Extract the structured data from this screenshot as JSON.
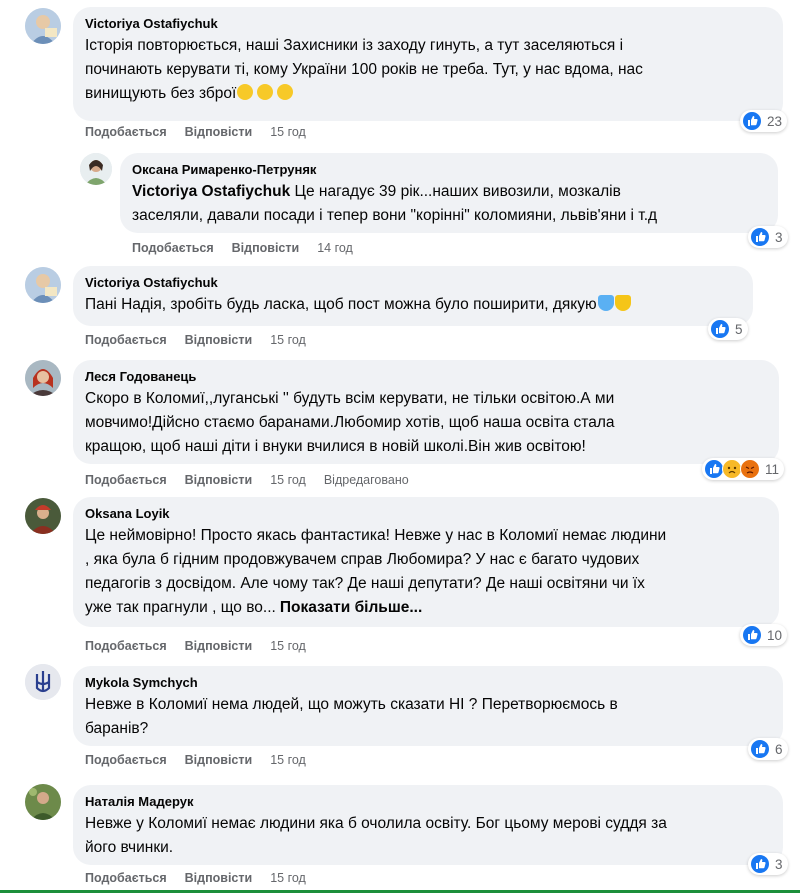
{
  "labels": {
    "like": "Подобається",
    "reply": "Відповісти"
  },
  "colors": {
    "like_blue": "#1877f2",
    "sad_yellow": "#f7b928",
    "angry_red": "#e9710f",
    "heart_blue": "#5ab0f3",
    "heart_yellow": "#f5c518"
  },
  "comments": [
    {
      "author": "Victoriya Ostafiychuk",
      "text_lines": [
        "Історія повторюється, наші Захисники із заходу гинуть, а тут заселяються і",
        "починають керувати ті, кому України 100 років не треба. Тут, у нас вдома, нас",
        "винищують без зброї"
      ],
      "emoji_suffix": [
        "sad-face",
        "sad-face",
        "sad-face"
      ],
      "time": "15 год",
      "reactions": [
        "like"
      ],
      "count": "23"
    },
    {
      "author": "Оксана Римаренко-Петруняк",
      "mention": "Victoriya Ostafiychuk",
      "text_lines": [
        " Це нагадує 39 рік...наших вивозили, мозкалів",
        "заселяли, давали посади і тепер вони \"корінні\" коломияни, львів'яни і т.д"
      ],
      "time": "14 год",
      "reactions": [
        "like"
      ],
      "count": "3"
    },
    {
      "author": "Victoriya Ostafiychuk",
      "text_lines": [
        "Пані Надія, зробіть будь ласка, щоб пост можна було поширити, дякую"
      ],
      "emoji_suffix": [
        "blue-heart",
        "yellow-heart"
      ],
      "time": "15 год",
      "reactions": [
        "like"
      ],
      "count": "5"
    },
    {
      "author": "Леся Годованець",
      "text_lines": [
        "Скоро в Коломиї,,луганські '' будуть всім керувати, не тільки освітою.А ми",
        "мовчимо!Дійсно стаємо баранами.Любомир хотів, щоб наша освіта стала",
        "кращою, щоб наші діти і внуки вчилися в новій школі.Він жив освітою!"
      ],
      "time": "15 год",
      "edited": "Відредаговано",
      "reactions": [
        "like",
        "sad",
        "angry"
      ],
      "count": "11"
    },
    {
      "author": "Oksana Loyik",
      "text_lines": [
        "Це неймовірно! Просто якась фантастика! Невже у нас в Коломиї немає людини",
        ", яка була б гідним продовжувачем справ Любомира? У нас є багато чудових",
        "педагогів з досвідом. Але чому так? Де наші депутати? Де наші освітяни чи їх",
        "уже так прагнули , що во..."
      ],
      "see_more": "Показати більше...",
      "time": "15 год",
      "reactions": [
        "like"
      ],
      "count": "10"
    },
    {
      "author": "Mykola Symchych",
      "text_lines": [
        "Невже в Коломиї нема людей, що можуть сказати НІ ? Перетворюємось в",
        "баранів?"
      ],
      "time": "15 год",
      "reactions": [
        "like"
      ],
      "count": "6"
    },
    {
      "author": "Наталія Мадерук",
      "text_lines": [
        "Невже у Коломиї немає людини яка б очолила освіту. Бог цьому мерові суддя за",
        "його вчинки."
      ],
      "time": "15 год",
      "reactions": [
        "like"
      ],
      "count": "3"
    }
  ]
}
